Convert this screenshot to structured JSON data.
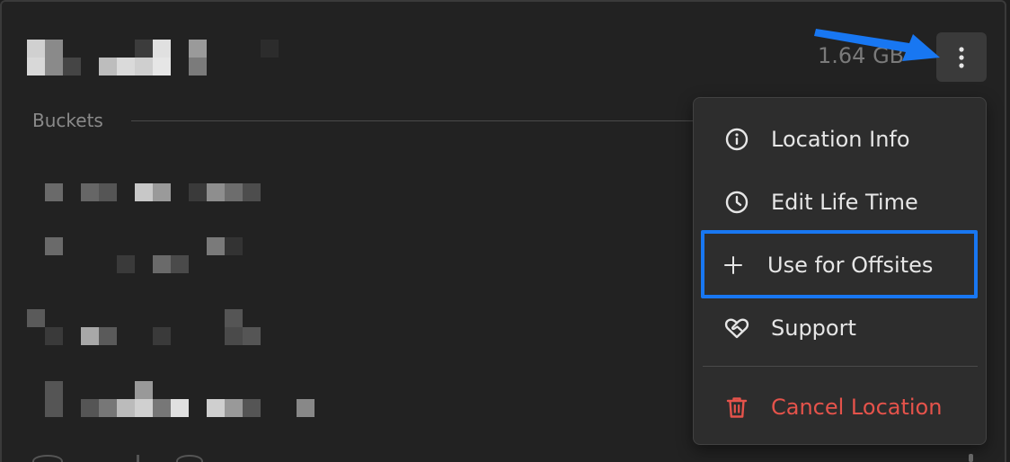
{
  "location": {
    "size": "1.64 GB"
  },
  "section": {
    "label": "Buckets"
  },
  "menu": {
    "items": [
      {
        "label": "Location Info",
        "icon": "info-circle-icon"
      },
      {
        "label": "Edit Life Time",
        "icon": "clock-icon"
      },
      {
        "label": "Use for Offsites",
        "icon": "plus-icon"
      },
      {
        "label": "Support",
        "icon": "heart-handshake-icon"
      },
      {
        "label": "Cancel Location",
        "icon": "trash-icon"
      }
    ]
  },
  "colors": {
    "accent": "#1877f2",
    "danger": "#e5534b",
    "menu_bg": "#2d2d2d",
    "card_bg": "#222222"
  }
}
